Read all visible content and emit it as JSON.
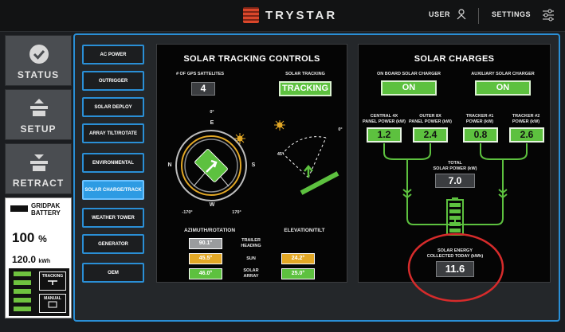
{
  "header": {
    "brand": "TRYSTAR",
    "user": "USER",
    "settings": "SETTINGS"
  },
  "leftnav": {
    "tabs": [
      {
        "label": "STATUS",
        "icon": "check-circle-icon"
      },
      {
        "label": "SETUP",
        "icon": "raise-array-icon"
      },
      {
        "label": "RETRACT",
        "icon": "lower-array-icon"
      }
    ],
    "battery": {
      "title_line1": "GRIDPAK",
      "title_line2": "BATTERY",
      "percent": "100",
      "percent_unit": "%",
      "energy": "120.0",
      "energy_unit": "kWh",
      "mode_tracking": "TRACKING",
      "mode_manual": "MANUAL",
      "level_bars": 5
    }
  },
  "menu": [
    "AC POWER",
    "OUTRIGGER",
    "SOLAR DEPLOY",
    "ARRAY TILT/ROTATE",
    "ENVIRONMENTAL",
    "SOLAR CHARGE/TRACK",
    "WEATHER TOWER",
    "GENERATOR",
    "OEM"
  ],
  "active_menu": "SOLAR CHARGE/TRACK",
  "tracking": {
    "title": "SOLAR TRACKING CONTROLS",
    "gps_label": "# OF GPS SATTELITES",
    "gps_value": "4",
    "tracking_label": "SOLAR TRACKING",
    "tracking_value": "TRACKING",
    "compass": {
      "top": "0°",
      "n": "N",
      "e": "E",
      "s": "S",
      "w": "W",
      "bl": "-170°",
      "br": "170°"
    },
    "elev_labels": {
      "zero": "0°",
      "fortyfive": "45°"
    },
    "azimuth_header": "AZIMUTH/ROTATION",
    "elevation_header": "ELEVATION/TILT",
    "rows": [
      {
        "label_1": "TRAILER",
        "label_2": "HEADING",
        "azimuth": "90.1°",
        "elevation": ""
      },
      {
        "label_1": "SUN",
        "label_2": "",
        "azimuth": "45.5°",
        "elevation": "24.2°"
      },
      {
        "label_1": "SOLAR",
        "label_2": "ARRAY",
        "azimuth": "46.0°",
        "elevation": "25.0°"
      }
    ]
  },
  "charges": {
    "title": "SOLAR CHARGES",
    "onboard_label": "ON BOARD SOLAR CHARGER",
    "onboard_value": "ON",
    "aux_label": "AUXILIARY SOLAR CHARGER",
    "aux_value": "ON",
    "panels": [
      {
        "l1": "CENTRAL 4X",
        "l2": "PANEL POWER (kW)",
        "value": "1.2"
      },
      {
        "l1": "OUTER 8X",
        "l2": "PANEL POWER (kW)",
        "value": "2.4"
      },
      {
        "l1": "TRACKER #1",
        "l2": "POWER (kW)",
        "value": "0.8"
      },
      {
        "l1": "TRACKER #2",
        "l2": "POWER (kW)",
        "value": "2.6"
      }
    ],
    "total_l1": "TOTAL",
    "total_l2": "SOLAR POWER (kW)",
    "total_value": "7.0",
    "energy_l1": "SOLAR ENERGY",
    "energy_l2": "COLLECTED TODAY (kWh)",
    "energy_value": "11.6"
  },
  "colors": {
    "accent": "#2a8fd6",
    "green": "#5dc13f",
    "amber": "#e3a826",
    "highlight": "#d62b2b"
  }
}
